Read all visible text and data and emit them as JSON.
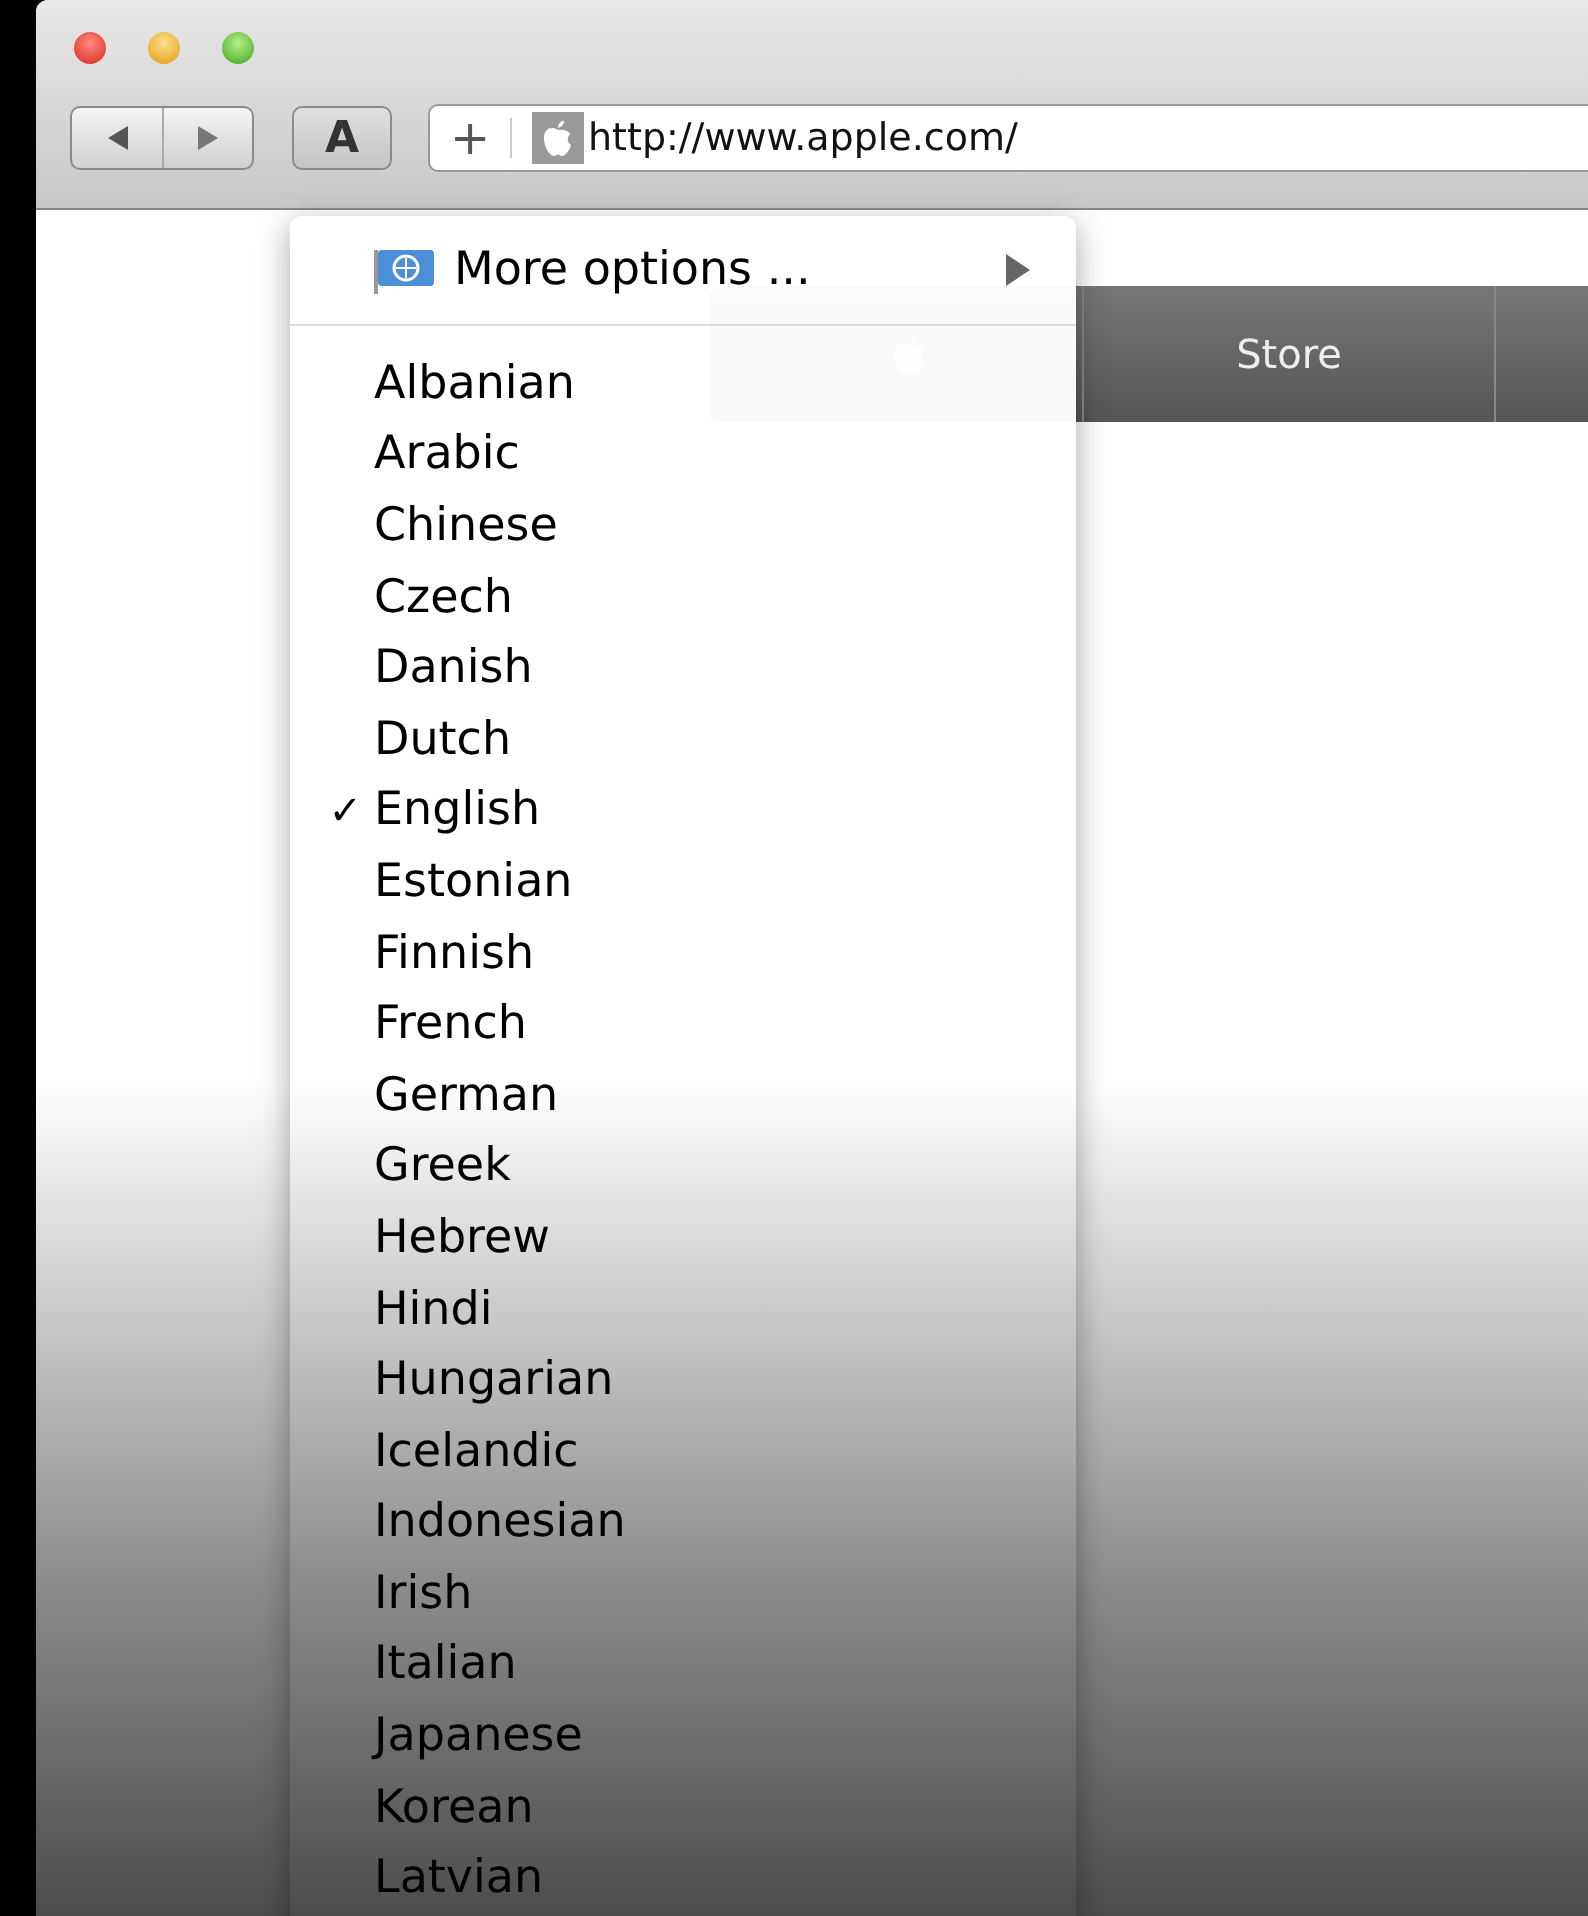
{
  "toolbar": {
    "text_button": "A",
    "add_button": "+",
    "url": "http://www.apple.com/"
  },
  "page_nav": {
    "items": [
      "Store"
    ]
  },
  "menu": {
    "more_options": {
      "label": "More options ...",
      "submenu": true
    },
    "check_mark": "✓",
    "languages": [
      {
        "label": "Albanian",
        "selected": false
      },
      {
        "label": "Arabic",
        "selected": false
      },
      {
        "label": "Chinese",
        "selected": false
      },
      {
        "label": "Czech",
        "selected": false
      },
      {
        "label": "Danish",
        "selected": false
      },
      {
        "label": "Dutch",
        "selected": false
      },
      {
        "label": "English",
        "selected": true
      },
      {
        "label": "Estonian",
        "selected": false
      },
      {
        "label": "Finnish",
        "selected": false
      },
      {
        "label": "French",
        "selected": false
      },
      {
        "label": "German",
        "selected": false
      },
      {
        "label": "Greek",
        "selected": false
      },
      {
        "label": "Hebrew",
        "selected": false
      },
      {
        "label": "Hindi",
        "selected": false
      },
      {
        "label": "Hungarian",
        "selected": false
      },
      {
        "label": "Icelandic",
        "selected": false
      },
      {
        "label": "Indonesian",
        "selected": false
      },
      {
        "label": "Irish",
        "selected": false
      },
      {
        "label": "Italian",
        "selected": false
      },
      {
        "label": "Japanese",
        "selected": false
      },
      {
        "label": "Korean",
        "selected": false
      },
      {
        "label": "Latvian",
        "selected": false
      }
    ]
  }
}
